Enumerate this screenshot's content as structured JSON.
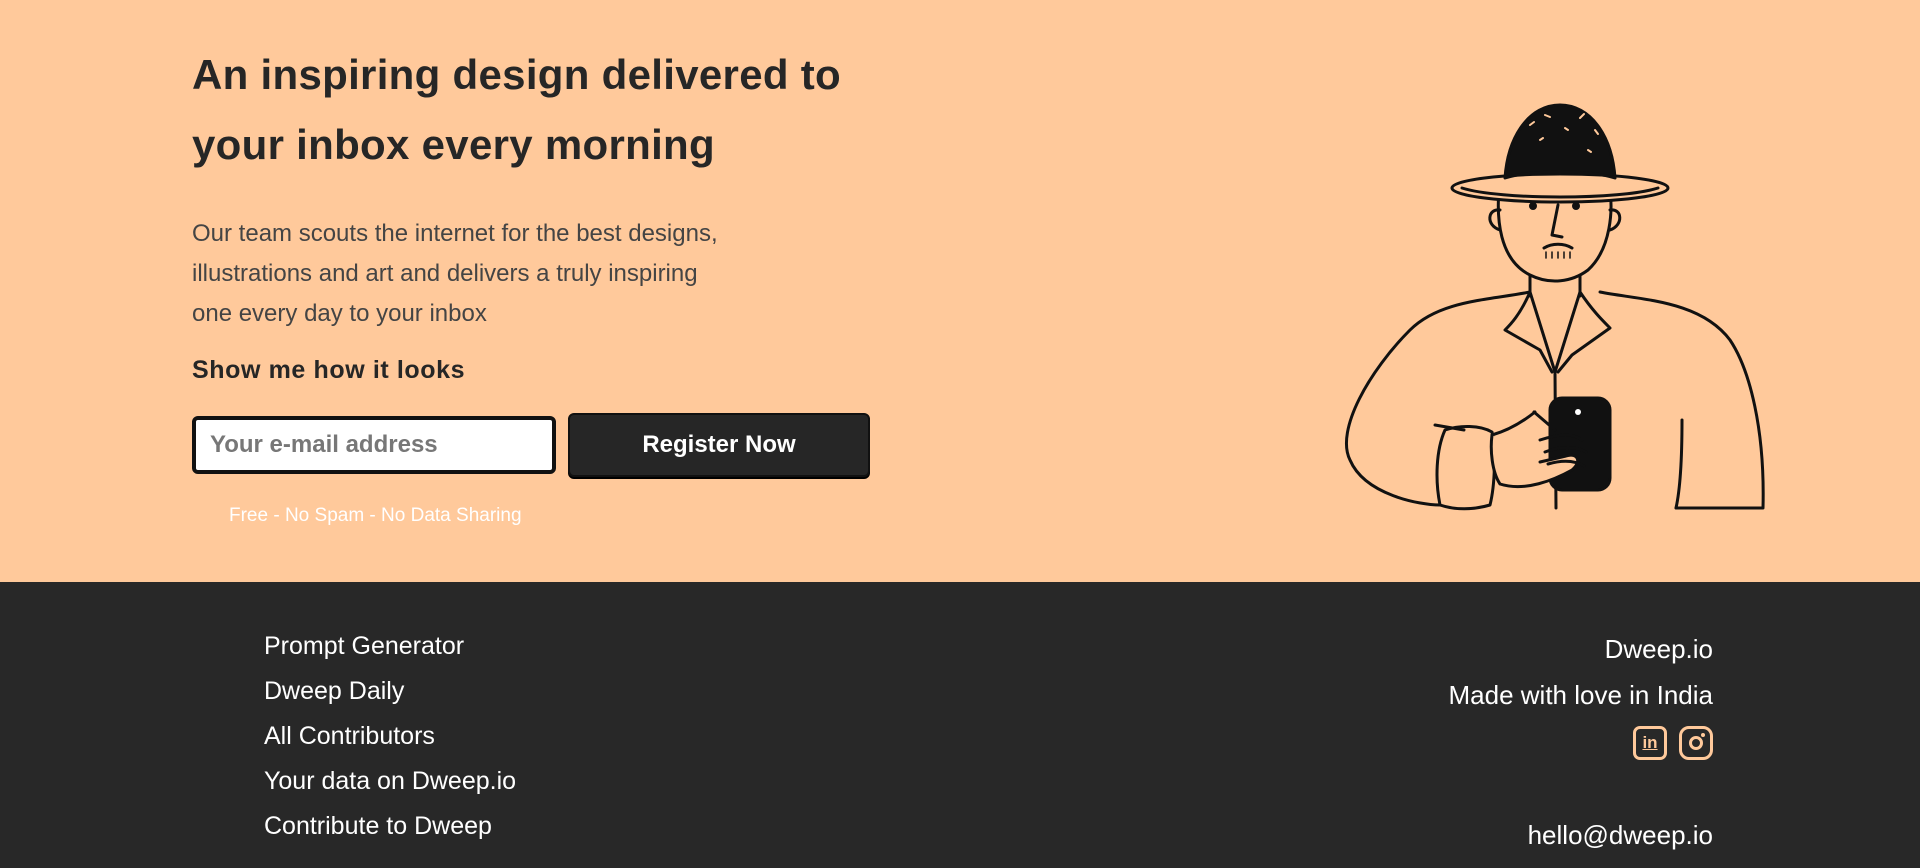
{
  "hero": {
    "headline_line1": "An inspiring design delivered to",
    "headline_line2": "your inbox every morning",
    "description_line1": "Our team scouts the internet for the best designs,",
    "description_line2": "illustrations and art and delivers a truly inspiring",
    "description_line3": "one every day to your inbox",
    "cta_title": "Show me how it looks",
    "email_placeholder": "Your e-mail address",
    "register_label": "Register Now",
    "note": "Free - No Spam - No Data Sharing"
  },
  "footer": {
    "links": [
      "Prompt Generator",
      "Dweep Daily",
      "All Contributors",
      "Your data on Dweep.io",
      "Contribute to Dweep"
    ],
    "brand": "Dweep.io",
    "tagline": "Made with love in India",
    "linkedin_label": "in",
    "email": "hello@dweep.io"
  },
  "colors": {
    "hero_background": "#ffc99b",
    "footer_background": "#282828",
    "icon_accent": "#ffc99b"
  },
  "icons": [
    "linkedin-icon",
    "instagram-icon"
  ]
}
